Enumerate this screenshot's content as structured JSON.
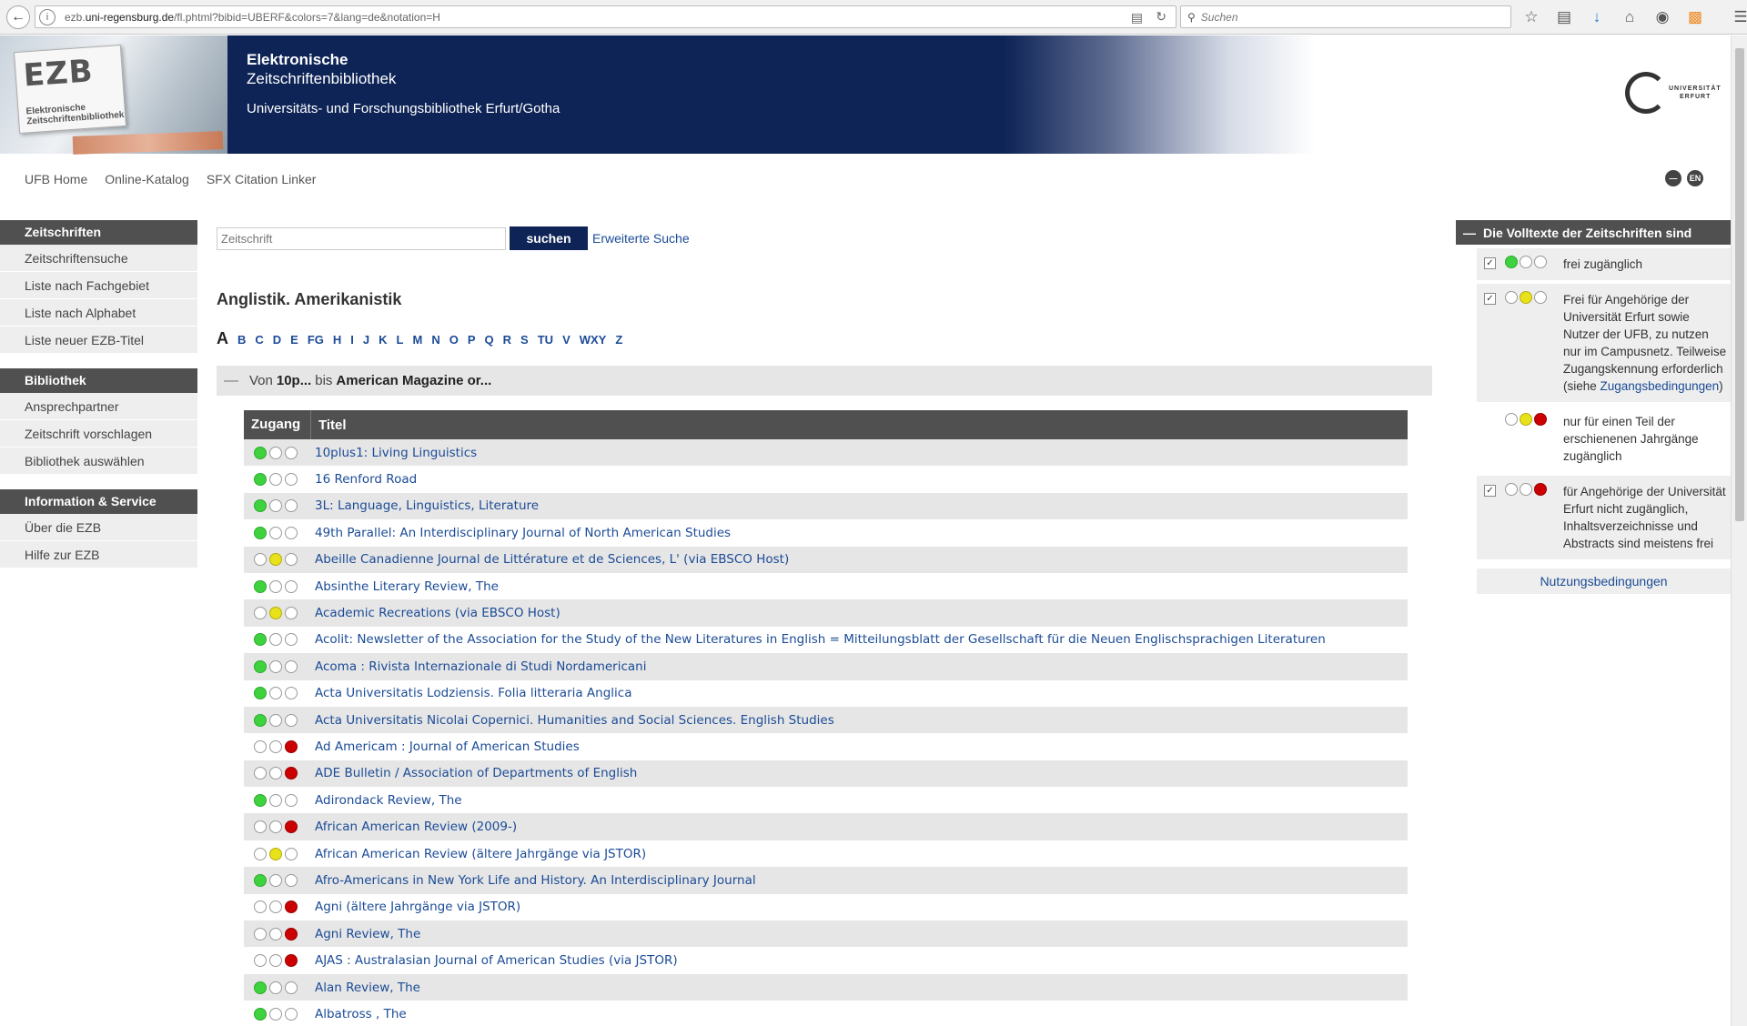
{
  "browser": {
    "url_prefix": "ezb.",
    "url_host": "uni-regensburg.de",
    "url_path": "/fl.phtml?bibid=UBERF&colors=7&lang=de&notation=H",
    "search_placeholder": "Suchen"
  },
  "header": {
    "logo_mark": "EZB",
    "logo_label_1": "Elektronische",
    "logo_label_2": "Zeitschriftenbibliothek",
    "title_line1": "Elektronische",
    "title_line2": "Zeitschriftenbibliothek",
    "subtitle": "Universitäts- und Forschungsbibliothek Erfurt/Gotha",
    "uni_logo_line1": "UNIVERSITÄT",
    "uni_logo_line2": "ERFURT",
    "lang_en": "EN"
  },
  "topnav": [
    "UFB Home",
    "Online-Katalog",
    "SFX Citation Linker"
  ],
  "sidebar": [
    {
      "title": "Zeitschriften",
      "items": [
        "Zeitschriftensuche",
        "Liste nach Fachgebiet",
        "Liste nach Alphabet",
        "Liste neuer EZB-Titel"
      ]
    },
    {
      "title": "Bibliothek",
      "items": [
        "Ansprechpartner",
        "Zeitschrift vorschlagen",
        "Bibliothek auswählen"
      ]
    },
    {
      "title": "Information & Service",
      "items": [
        "Über die EZB",
        "Hilfe zur EZB"
      ]
    }
  ],
  "search": {
    "placeholder": "Zeitschrift",
    "button": "suchen",
    "advanced": "Erweiterte Suche"
  },
  "subject_title": "Anglistik. Amerikanistik",
  "alphabet": {
    "current": "A",
    "letters": [
      "B",
      "C",
      "D",
      "E",
      "FG",
      "H",
      "I",
      "J",
      "K",
      "L",
      "M",
      "N",
      "O",
      "P",
      "Q",
      "R",
      "S",
      "TU",
      "V",
      "WXY",
      "Z"
    ]
  },
  "range": {
    "prefix": "Von",
    "from": "10p...",
    "mid": "bis",
    "to": "American Magazine or..."
  },
  "table": {
    "col_access": "Zugang",
    "col_title": "Titel",
    "rows": [
      {
        "access": "g",
        "title": "10plus1: Living Linguistics"
      },
      {
        "access": "g",
        "title": "16 Renford Road"
      },
      {
        "access": "g",
        "title": "3L: Language, Linguistics, Literature"
      },
      {
        "access": "g",
        "title": "49th Parallel: An Interdisciplinary Journal of North American Studies"
      },
      {
        "access": "y",
        "title": "Abeille Canadienne Journal de Littérature et de Sciences, L' (via EBSCO Host)"
      },
      {
        "access": "g",
        "title": "Absinthe Literary Review, The"
      },
      {
        "access": "y",
        "title": "Academic Recreations (via EBSCO Host)"
      },
      {
        "access": "g",
        "title": "Acolit: Newsletter of the Association for the Study of the New Literatures in English = Mitteilungsblatt der Gesellschaft für die Neuen Englischsprachigen Literaturen"
      },
      {
        "access": "g",
        "title": "Acoma : Rivista Internazionale di Studi Nordamericani"
      },
      {
        "access": "g",
        "title": "Acta Universitatis Lodziensis. Folia litteraria Anglica"
      },
      {
        "access": "g",
        "title": "Acta Universitatis Nicolai Copernici. Humanities and Social Sciences. English Studies"
      },
      {
        "access": "r",
        "title": "Ad Americam : Journal of American Studies"
      },
      {
        "access": "r",
        "title": "ADE Bulletin / Association of Departments of English"
      },
      {
        "access": "g",
        "title": "Adirondack Review, The"
      },
      {
        "access": "r",
        "title": "African American Review (2009-)"
      },
      {
        "access": "y",
        "title": "African American Review (ältere Jahrgänge via JSTOR)"
      },
      {
        "access": "g",
        "title": "Afro-Americans in New York Life and History. An Interdisciplinary Journal"
      },
      {
        "access": "r",
        "title": "Agni (ältere Jahrgänge via JSTOR)"
      },
      {
        "access": "r",
        "title": "Agni Review, The"
      },
      {
        "access": "r",
        "title": "AJAS : Australasian Journal of American Studies (via JSTOR)"
      },
      {
        "access": "g",
        "title": "Alan Review, The"
      },
      {
        "access": "g",
        "title": "Albatross , The"
      }
    ]
  },
  "legend": {
    "title": "Die Volltexte der Zeitschriften sind",
    "items": [
      {
        "checked": true,
        "lights": "g",
        "text": "frei zugänglich"
      },
      {
        "checked": true,
        "lights": "y",
        "text": "Frei für Angehörige der Universität Erfurt sowie Nutzer der UFB, zu nutzen nur im Campusnetz. Teilweise Zugangskennung erforderlich (siehe ",
        "link": "Zugangsbedingungen",
        "after": ")"
      },
      {
        "checked": false,
        "lights": "yr",
        "text": "nur für einen Teil der erschienenen Jahrgänge zugänglich"
      },
      {
        "checked": true,
        "lights": "r",
        "text": "für Angehörige der Universität Erfurt nicht zugänglich, Inhaltsverzeichnisse und Abstracts sind meistens frei"
      }
    ],
    "footer": "Nutzungsbedingungen"
  },
  "colors": {
    "green": "#3fd23f",
    "yellow": "#e8e21a",
    "red": "#cc0000",
    "navy": "#0e2456",
    "link": "#1b4b96"
  }
}
